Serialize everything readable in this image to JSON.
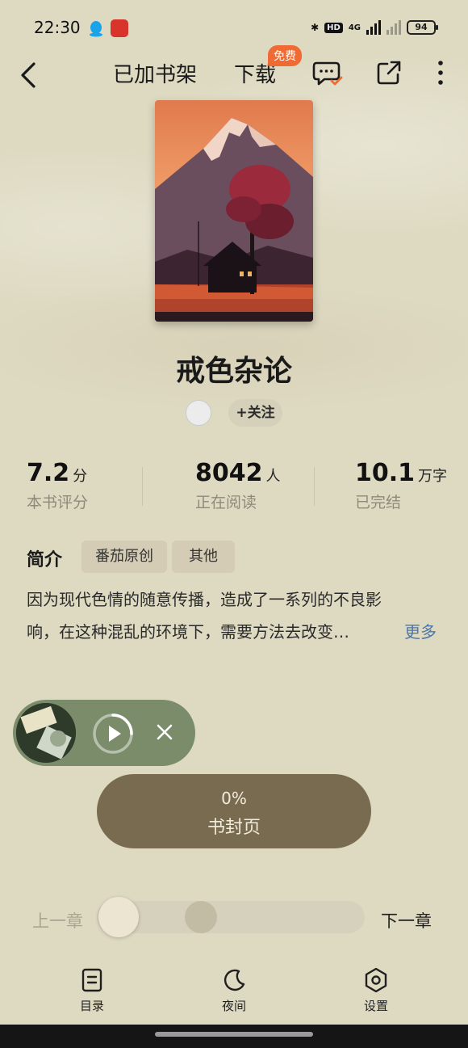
{
  "status_bar": {
    "time": "22:30",
    "hd_label": "HD",
    "network": "4G",
    "battery": "94"
  },
  "nav": {
    "shelf_label": "已加书架",
    "download_label": "下载",
    "free_badge": "免费"
  },
  "book": {
    "title": "戒色杂论",
    "follow_label": "+关注"
  },
  "stats": [
    {
      "value": "7.2",
      "unit": "分",
      "label": "本书评分"
    },
    {
      "value": "8042",
      "unit": "人",
      "label": "正在阅读"
    },
    {
      "value": "10.1",
      "unit": "万字",
      "label": "已完结"
    }
  ],
  "intro": {
    "heading": "简介",
    "tags": [
      "番茄原创",
      "其他"
    ],
    "line1": "因为现代色情的随意传播，造成了一系列的不良影",
    "line2": "响，在这种混乱的环境下，需要方法去改变…",
    "more_label": "更多"
  },
  "progress": {
    "percent": "0%",
    "page_label": "书封页"
  },
  "chapter_nav": {
    "prev_label": "上一章",
    "next_label": "下一章",
    "position": 0
  },
  "bottom_bar": {
    "toc_label": "目录",
    "night_label": "夜间",
    "settings_label": "设置"
  },
  "colors": {
    "background": "#dedac2",
    "player": "#7a8c6a",
    "page_pill": "#796b50",
    "free_badge": "#f06a33",
    "more_link": "#4d76a8"
  }
}
